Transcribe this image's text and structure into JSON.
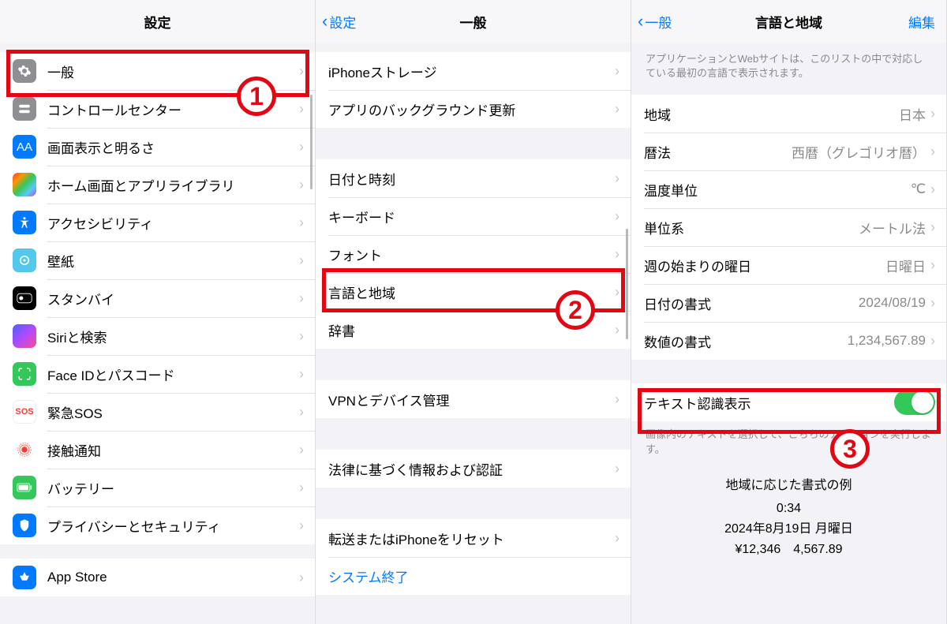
{
  "panel1": {
    "title": "設定",
    "items": [
      {
        "label": "一般"
      },
      {
        "label": "コントロールセンター"
      },
      {
        "label": "画面表示と明るさ"
      },
      {
        "label": "ホーム画面とアプリライブラリ"
      },
      {
        "label": "アクセシビリティ"
      },
      {
        "label": "壁紙"
      },
      {
        "label": "スタンバイ"
      },
      {
        "label": "Siriと検索"
      },
      {
        "label": "Face IDとパスコード"
      },
      {
        "label": "緊急SOS"
      },
      {
        "label": "接触通知"
      },
      {
        "label": "バッテリー"
      },
      {
        "label": "プライバシーとセキュリティ"
      }
    ],
    "group2": [
      {
        "label": "App Store"
      }
    ]
  },
  "panel2": {
    "back": "設定",
    "title": "一般",
    "g1": [
      {
        "label": "iPhoneストレージ"
      },
      {
        "label": "アプリのバックグラウンド更新"
      }
    ],
    "g2": [
      {
        "label": "日付と時刻"
      },
      {
        "label": "キーボード"
      },
      {
        "label": "フォント"
      },
      {
        "label": "言語と地域"
      },
      {
        "label": "辞書"
      }
    ],
    "g3": [
      {
        "label": "VPNとデバイス管理"
      }
    ],
    "g4": [
      {
        "label": "法律に基づく情報および認証"
      }
    ],
    "g5": [
      {
        "label": "転送またはiPhoneをリセット"
      },
      {
        "label": "システム終了"
      }
    ]
  },
  "panel3": {
    "back": "一般",
    "title": "言語と地域",
    "edit": "編集",
    "note": "アプリケーションとWebサイトは、このリストの中で対応している最初の言語で表示されます。",
    "rows": [
      {
        "label": "地域",
        "value": "日本"
      },
      {
        "label": "暦法",
        "value": "西暦（グレゴリオ暦）"
      },
      {
        "label": "温度単位",
        "value": "℃"
      },
      {
        "label": "単位系",
        "value": "メートル法"
      },
      {
        "label": "週の始まりの曜日",
        "value": "日曜日"
      },
      {
        "label": "日付の書式",
        "value": "2024/08/19"
      },
      {
        "label": "数値の書式",
        "value": "1,234,567.89"
      }
    ],
    "text_recog": "テキスト認識表示",
    "text_recog_note": "画像内のテキストを選択して、こちらのアクションを実行します。",
    "example_header": "地域に応じた書式の例",
    "example_time": "0:34",
    "example_date": "2024年8月19日 月曜日",
    "example_num": "¥12,346　4,567.89"
  },
  "badges": {
    "b1": "1",
    "b2": "2",
    "b3": "3"
  }
}
